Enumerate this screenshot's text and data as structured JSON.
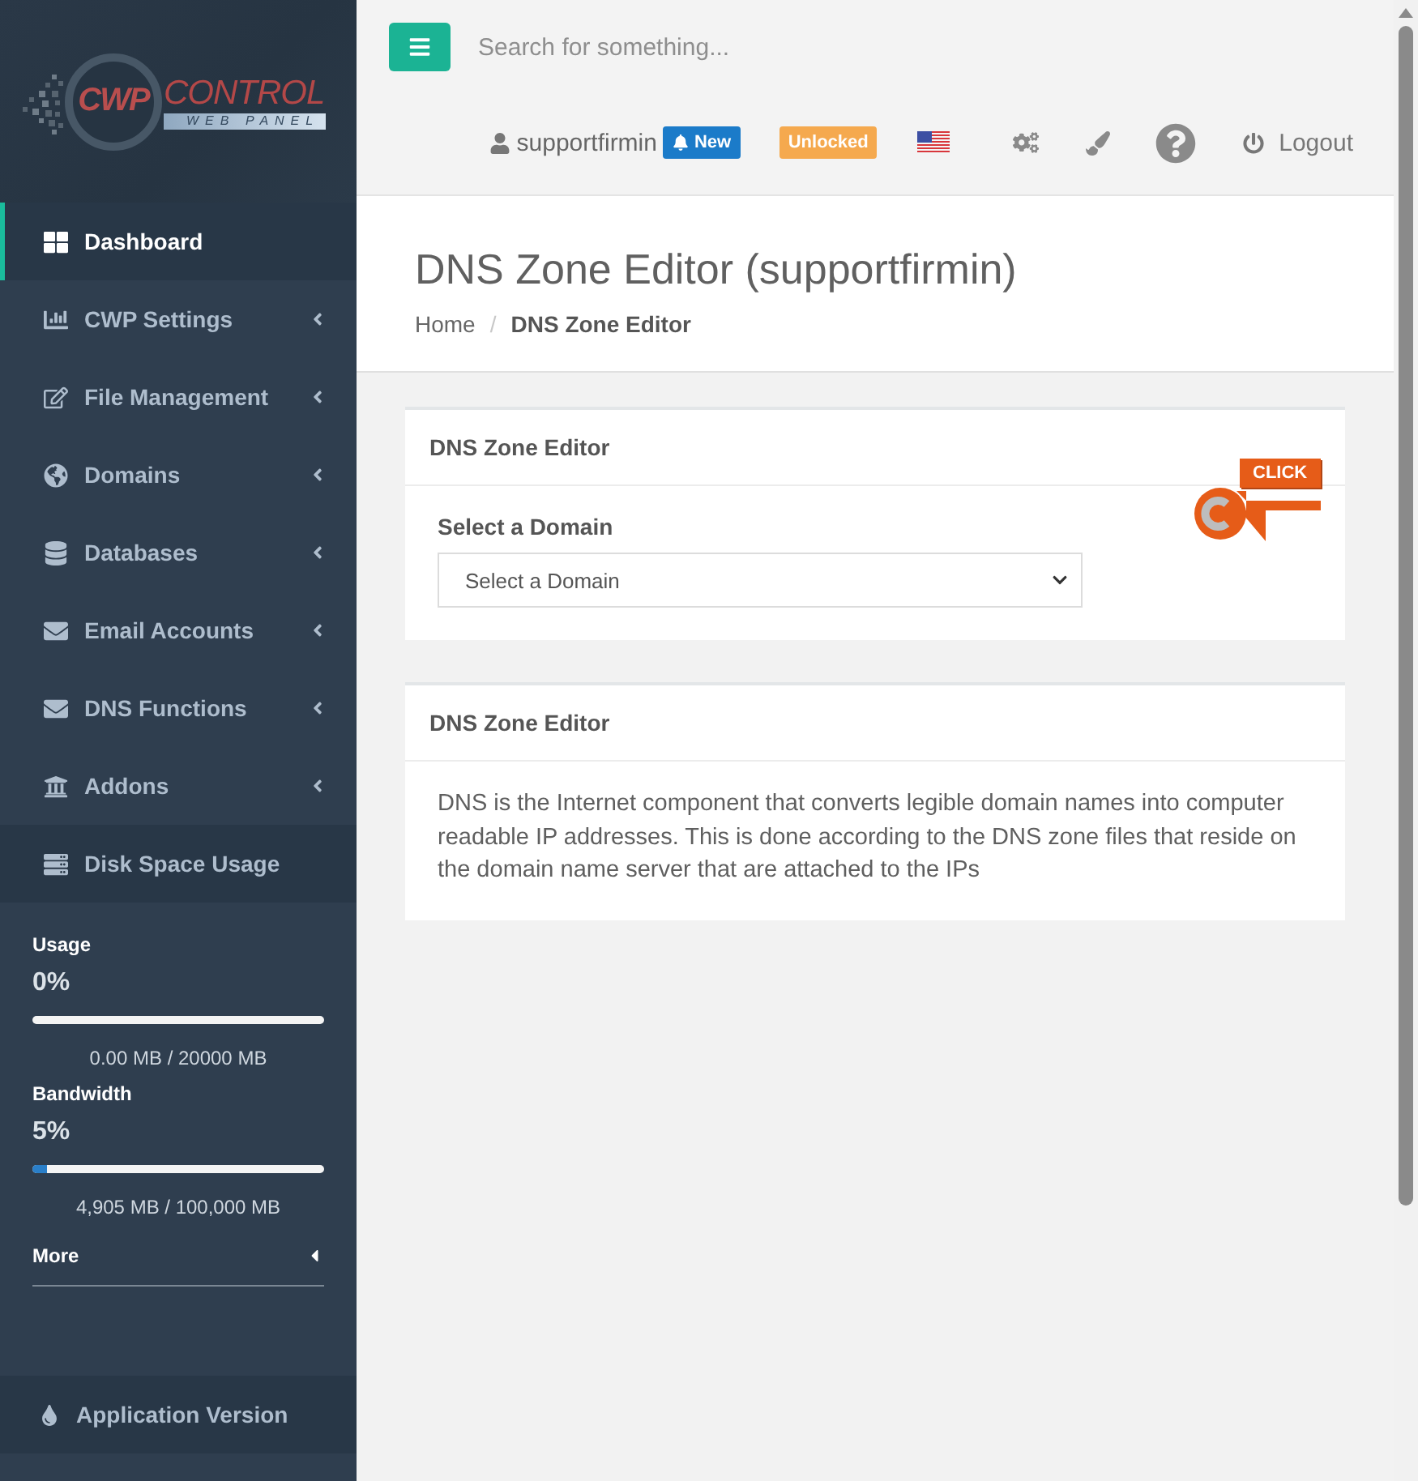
{
  "sidebar": {
    "logo": {
      "mark": "CWP",
      "name": "CONTROL",
      "tagline": "WEB PANEL"
    },
    "menu": [
      {
        "label": "Dashboard",
        "selected": true,
        "expandable": false
      },
      {
        "label": "CWP Settings",
        "selected": false,
        "expandable": true
      },
      {
        "label": "File Management",
        "selected": false,
        "expandable": true
      },
      {
        "label": "Domains",
        "selected": false,
        "expandable": true
      },
      {
        "label": "Databases",
        "selected": false,
        "expandable": true
      },
      {
        "label": "Email Accounts",
        "selected": false,
        "expandable": true
      },
      {
        "label": "DNS Functions",
        "selected": false,
        "expandable": true
      },
      {
        "label": "Addons",
        "selected": false,
        "expandable": true
      }
    ],
    "usage_panel": {
      "title": "Disk Space Usage",
      "meters": [
        {
          "label": "Usage",
          "percent": "0%",
          "detail": "0.00 MB / 20000 MB"
        },
        {
          "label": "Bandwidth",
          "percent": "5%",
          "level": 0.05,
          "detail": "4,905 MB / 100,000 MB"
        }
      ],
      "more": "More"
    },
    "footer": {
      "label": "Application Version"
    }
  },
  "topbar": {
    "search": {
      "placeholder": "Search for something..."
    },
    "user": "supportfirmin",
    "notification_badge": "New",
    "status_badge": "Unlocked",
    "logout": "Logout"
  },
  "page_header": {
    "title": "DNS Zone Editor (supportfirmin)",
    "breadcrumb": [
      {
        "label": "Home",
        "current": false
      },
      {
        "label": "DNS Zone Editor",
        "current": true
      }
    ],
    "separator": "/"
  },
  "cards": [
    {
      "kind": "form",
      "title": "DNS Zone Editor",
      "field_label": "Select a Domain",
      "select_value": "Select a Domain"
    },
    {
      "kind": "text",
      "title": "DNS Zone Editor",
      "body": "DNS is the Internet component that converts legible domain names into computer readable IP addresses. This is done according to the DNS zone files that reside on the domain name server that are attached to the IPs"
    }
  ],
  "click_marker": {
    "label": "CLICK"
  }
}
